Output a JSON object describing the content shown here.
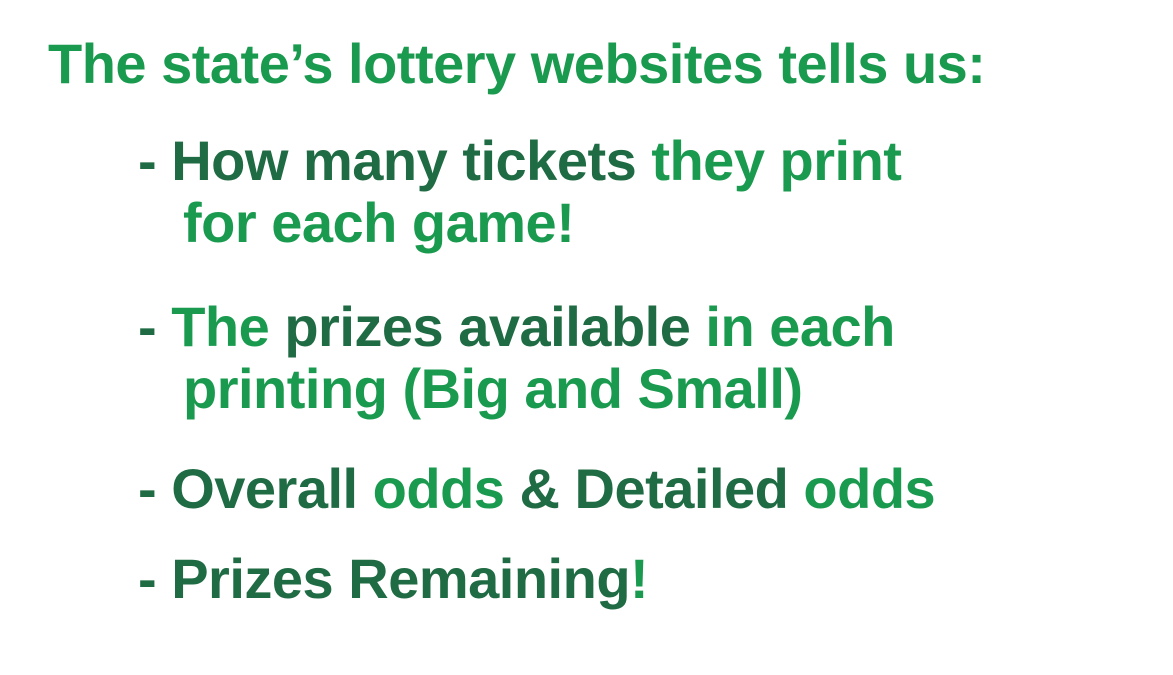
{
  "colors": {
    "light_green": "#1a9a4f",
    "dark_green": "#1f6b43",
    "background": "#ffffff"
  },
  "headline": "The state’s lottery websites tells us:",
  "bullets": [
    {
      "line1": [
        {
          "text": "- How many tickets ",
          "tone": "dark"
        },
        {
          "text": "they print",
          "tone": "light"
        }
      ],
      "line2": [
        {
          "text": "for each game!",
          "tone": "light"
        }
      ]
    },
    {
      "line1": [
        {
          "text": "- ",
          "tone": "dark"
        },
        {
          "text": "The ",
          "tone": "light"
        },
        {
          "text": "prizes available ",
          "tone": "dark"
        },
        {
          "text": "in each",
          "tone": "light"
        }
      ],
      "line2": [
        {
          "text": "printing (Big and Small)",
          "tone": "light"
        }
      ]
    },
    {
      "line1": [
        {
          "text": "- Overall ",
          "tone": "dark"
        },
        {
          "text": "odds ",
          "tone": "light"
        },
        {
          "text": "& Detailed ",
          "tone": "dark"
        },
        {
          "text": "odds",
          "tone": "light"
        }
      ]
    },
    {
      "line1": [
        {
          "text": "- Prizes Remaining",
          "tone": "dark"
        },
        {
          "text": "!",
          "tone": "light"
        }
      ]
    }
  ]
}
